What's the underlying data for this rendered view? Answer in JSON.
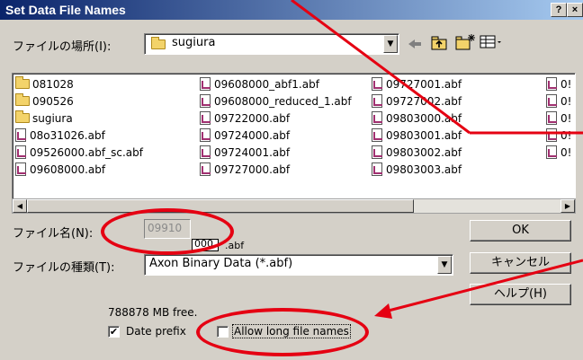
{
  "window": {
    "title": "Set Data File Names",
    "help_btn": "?",
    "close_btn": "×"
  },
  "location": {
    "label": "ファイルの場所(I):",
    "folder": "sugiura"
  },
  "toolbar_icons": [
    "back-icon",
    "up-folder-icon",
    "new-folder-icon",
    "view-menu-icon"
  ],
  "files": {
    "col1": [
      {
        "name": "081028",
        "type": "folder"
      },
      {
        "name": "090526",
        "type": "folder"
      },
      {
        "name": "sugiura",
        "type": "folder"
      },
      {
        "name": "08o31026.abf",
        "type": "file"
      },
      {
        "name": "09526000.abf_sc.abf",
        "type": "file"
      },
      {
        "name": "09608000.abf",
        "type": "file"
      }
    ],
    "col2": [
      {
        "name": "09608000_abf1.abf",
        "type": "file"
      },
      {
        "name": "09608000_reduced_1.abf",
        "type": "file"
      },
      {
        "name": "09722000.abf",
        "type": "file"
      },
      {
        "name": "09724000.abf",
        "type": "file"
      },
      {
        "name": "09724001.abf",
        "type": "file"
      },
      {
        "name": "09727000.abf",
        "type": "file"
      }
    ],
    "col3": [
      {
        "name": "09727001.abf",
        "type": "file"
      },
      {
        "name": "09727002.abf",
        "type": "file"
      },
      {
        "name": "09803000.abf",
        "type": "file"
      },
      {
        "name": "09803001.abf",
        "type": "file"
      },
      {
        "name": "09803002.abf",
        "type": "file"
      },
      {
        "name": "09803003.abf",
        "type": "file"
      }
    ],
    "col4": [
      {
        "name": "0!",
        "type": "file"
      },
      {
        "name": "0!",
        "type": "file"
      },
      {
        "name": "0!",
        "type": "file"
      },
      {
        "name": "0!",
        "type": "file"
      },
      {
        "name": "0!",
        "type": "file"
      }
    ]
  },
  "filename": {
    "label": "ファイル名(N):",
    "value": "09910",
    "number": "000",
    "ext": ".abf"
  },
  "filetype": {
    "label": "ファイルの種類(T):",
    "value": "Axon Binary Data (*.abf)"
  },
  "buttons": {
    "ok": "OK",
    "cancel": "キャンセル",
    "help": "ヘルプ(H)"
  },
  "free_space": "788878 MB free.",
  "options": {
    "date_prefix": {
      "label": "Date prefix",
      "checked": true,
      "mark": "✔"
    },
    "long_names": {
      "label": "Allow long file names",
      "checked": false
    }
  },
  "annotation_color": "#e50012"
}
